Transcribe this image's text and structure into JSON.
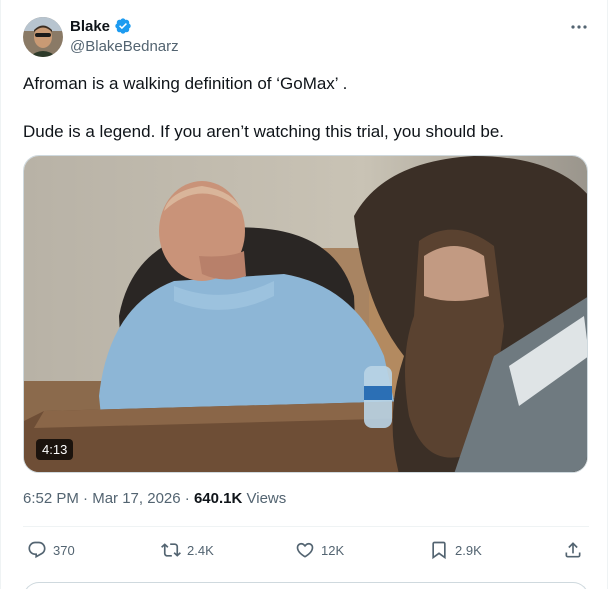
{
  "author": {
    "display_name": "Blake",
    "handle": "@BlakeBednarz",
    "verified": true
  },
  "tweet": {
    "paragraphs": [
      "Afroman is a walking definition of ‘GoMax’ .",
      "Dude is a legend. If you aren’t watching this trial, you should be."
    ]
  },
  "media": {
    "duration": "4:13"
  },
  "meta": {
    "time": "6:52 PM",
    "separator": "·",
    "date": "Mar 17, 2026",
    "views_count": "640.1K",
    "views_label": "Views"
  },
  "actions": {
    "replies": "370",
    "reposts": "2.4K",
    "likes": "12K",
    "bookmarks": "2.9K"
  },
  "colors": {
    "accent": "#1d9bf0",
    "secondary_text": "#536471",
    "primary_text": "#0f1419"
  }
}
